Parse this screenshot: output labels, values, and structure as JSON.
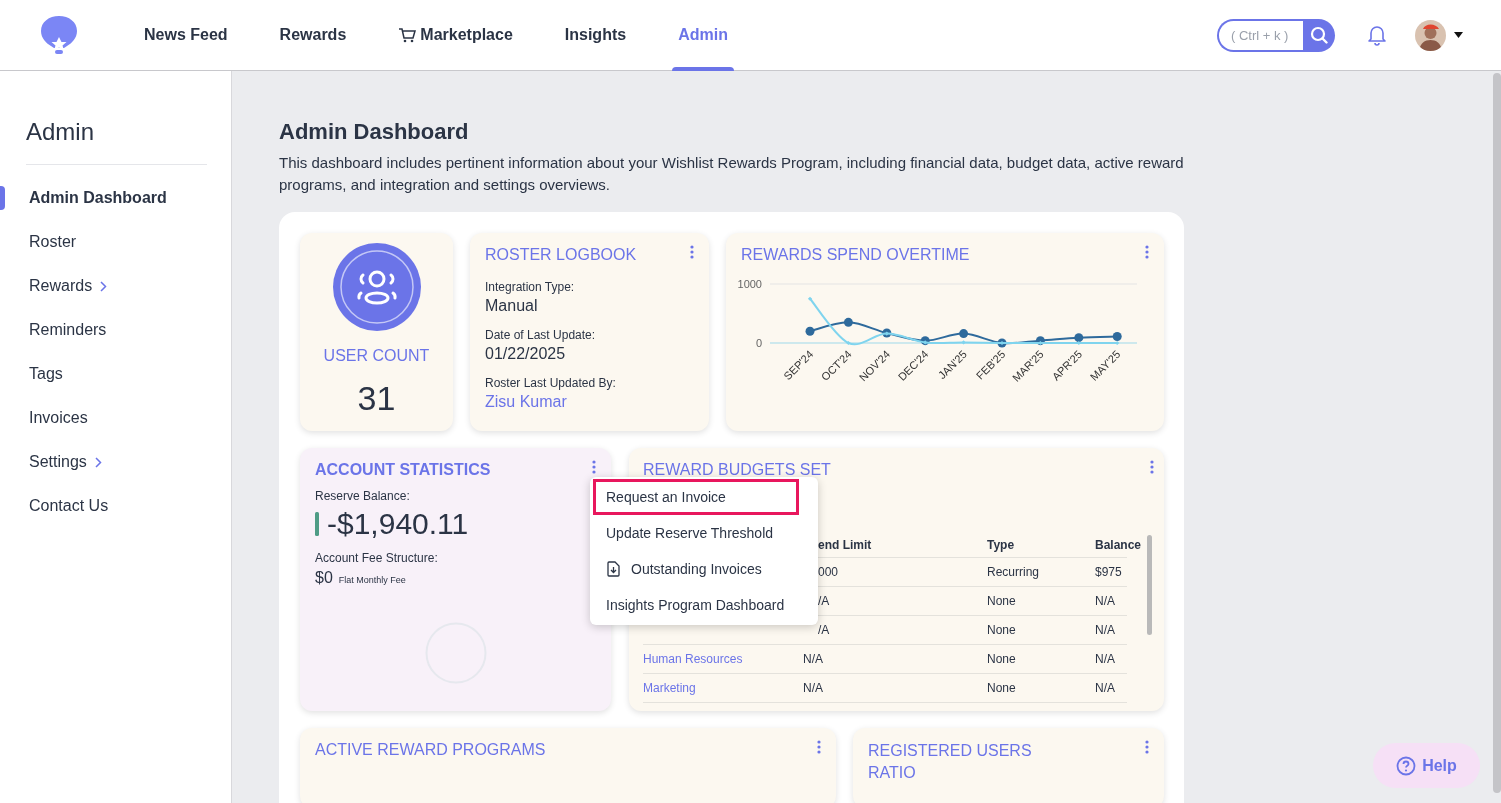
{
  "nav": {
    "items": [
      {
        "label": "News Feed",
        "selected": false,
        "kind": "plain"
      },
      {
        "label": "Rewards",
        "selected": false,
        "kind": "plain"
      },
      {
        "label": "Marketplace",
        "selected": false,
        "kind": "cart"
      },
      {
        "label": "Insights",
        "selected": false,
        "kind": "plain"
      },
      {
        "label": "Admin",
        "selected": true,
        "kind": "plain"
      }
    ]
  },
  "search": {
    "placeholder": "( Ctrl + k )"
  },
  "sidebar": {
    "title": "Admin",
    "items": [
      {
        "label": "Admin Dashboard",
        "selected": true,
        "has_submenu": false
      },
      {
        "label": "Roster",
        "selected": false,
        "has_submenu": false
      },
      {
        "label": "Rewards",
        "selected": false,
        "has_submenu": true
      },
      {
        "label": "Reminders",
        "selected": false,
        "has_submenu": false
      },
      {
        "label": "Tags",
        "selected": false,
        "has_submenu": false
      },
      {
        "label": "Invoices",
        "selected": false,
        "has_submenu": false
      },
      {
        "label": "Settings",
        "selected": false,
        "has_submenu": true
      },
      {
        "label": "Contact Us",
        "selected": false,
        "has_submenu": false
      }
    ]
  },
  "page": {
    "title": "Admin Dashboard",
    "description": "This dashboard includes pertinent information about your Wishlist Rewards Program, including financial data, budget data, active reward programs, and integration and settings overviews."
  },
  "user_count": {
    "title": "USER COUNT",
    "value": "31"
  },
  "roster_logbook": {
    "title": "ROSTER LOGBOOK",
    "fields": [
      {
        "label": "Integration Type:",
        "value": "Manual",
        "kind": "text"
      },
      {
        "label": "Date of Last Update:",
        "value": "01/22/2025",
        "kind": "text"
      },
      {
        "label": "Roster Last Updated By:",
        "value": "Zisu Kumar",
        "kind": "link"
      }
    ]
  },
  "rewards_spend": {
    "title": "REWARDS SPEND OVERTIME",
    "chart_data": {
      "type": "line",
      "categories": [
        "SEP'24",
        "OCT'24",
        "NOV'24",
        "DEC'24",
        "JAN'25",
        "FEB'25",
        "MAR'25",
        "APR'25",
        "MAY'25"
      ],
      "ylim": [
        0,
        1000
      ],
      "yticks": [
        0,
        1000
      ],
      "series": [
        {
          "color": "#2e6a9c",
          "marker": "circle",
          "values": [
            200,
            350,
            170,
            40,
            160,
            0,
            40,
            90,
            110
          ]
        },
        {
          "color": "#7fd4ee",
          "marker": "diamond",
          "values": [
            750,
            0,
            160,
            10,
            10,
            0,
            0,
            0,
            0
          ]
        }
      ]
    }
  },
  "account_statistics": {
    "title": "ACCOUNT STATISTICS",
    "reserve_label": "Reserve Balance:",
    "reserve_value": "-$1,940.11",
    "fee_label": "Account Fee Structure:",
    "fee_value": "$0",
    "fee_note": "Flat Monthly Fee"
  },
  "reward_budgets": {
    "title": "REWARD BUDGETS SET",
    "columns": [
      "end Limit",
      "Type",
      "Balance"
    ],
    "rows": [
      {
        "limit": "000",
        "type": "Recurring",
        "balance": "$975"
      },
      {
        "limit": "/A",
        "type": "None",
        "balance": "N/A"
      },
      {
        "limit": "/A",
        "type": "None",
        "balance": "N/A"
      },
      {
        "name": "Human Resources",
        "limit": "N/A",
        "type": "None",
        "balance": "N/A"
      },
      {
        "name": "Marketing",
        "limit": "N/A",
        "type": "None",
        "balance": "N/A"
      }
    ]
  },
  "active_reward_programs": {
    "title": "ACTIVE REWARD PROGRAMS"
  },
  "registered_users_ratio": {
    "title": "REGISTERED USERS RATIO"
  },
  "menu": {
    "items": [
      {
        "label": "Request an Invoice",
        "selected": true,
        "kind": "plain"
      },
      {
        "label": "Update Reserve Threshold",
        "selected": false,
        "kind": "plain"
      },
      {
        "label": "Outstanding Invoices",
        "selected": false,
        "kind": "download"
      },
      {
        "label": "Insights Program Dashboard",
        "selected": false,
        "kind": "plain"
      }
    ]
  },
  "help": {
    "label": "Help"
  }
}
